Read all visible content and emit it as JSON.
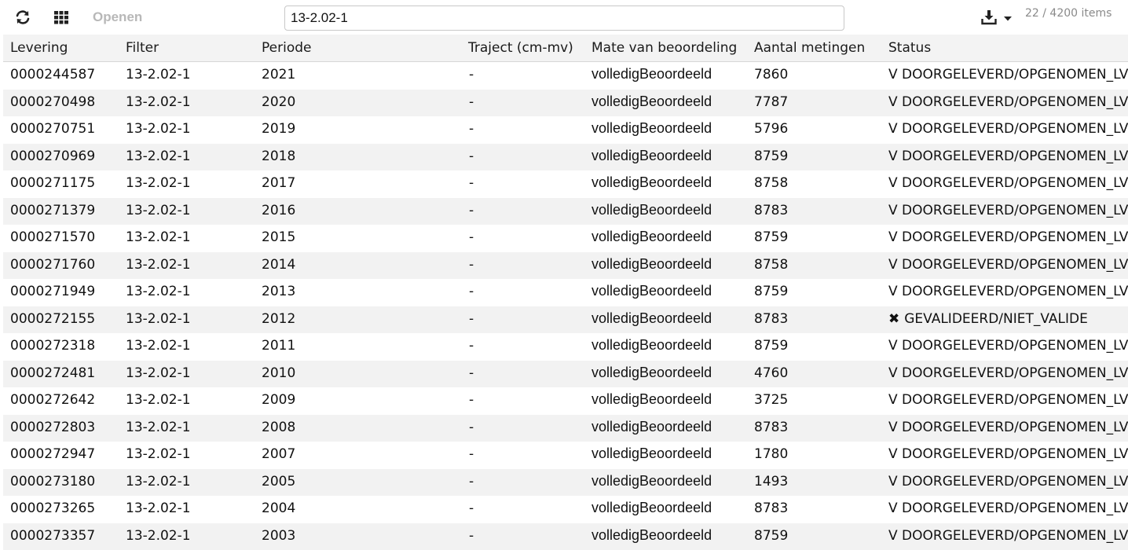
{
  "toolbar": {
    "refresh_icon": "refresh-icon",
    "grid_icon": "grid-icon",
    "open_label": "Openen",
    "search_value": "13-2.02-1",
    "download_icon": "download-icon",
    "dropdown_icon": "caret-down-icon",
    "item_count": "22 / 4200 items"
  },
  "table": {
    "headers": [
      "Levering",
      "Filter",
      "Periode",
      "Traject (cm-mv)",
      "Mate van beoordeling",
      "Aantal metingen",
      "Status"
    ],
    "rows": [
      {
        "levering": "0000244587",
        "filter": "13-2.02-1",
        "periode": "2021",
        "traject": "-",
        "mate": "volledigBeoordeeld",
        "aantal": "7860",
        "status_mark": "V",
        "status": "DOORGELEVERD/OPGENOMEN_LV"
      },
      {
        "levering": "0000270498",
        "filter": "13-2.02-1",
        "periode": "2020",
        "traject": "-",
        "mate": "volledigBeoordeeld",
        "aantal": "7787",
        "status_mark": "V",
        "status": "DOORGELEVERD/OPGENOMEN_LV"
      },
      {
        "levering": "0000270751",
        "filter": "13-2.02-1",
        "periode": "2019",
        "traject": "-",
        "mate": "volledigBeoordeeld",
        "aantal": "5796",
        "status_mark": "V",
        "status": "DOORGELEVERD/OPGENOMEN_LV"
      },
      {
        "levering": "0000270969",
        "filter": "13-2.02-1",
        "periode": "2018",
        "traject": "-",
        "mate": "volledigBeoordeeld",
        "aantal": "8759",
        "status_mark": "V",
        "status": "DOORGELEVERD/OPGENOMEN_LV"
      },
      {
        "levering": "0000271175",
        "filter": "13-2.02-1",
        "periode": "2017",
        "traject": "-",
        "mate": "volledigBeoordeeld",
        "aantal": "8758",
        "status_mark": "V",
        "status": "DOORGELEVERD/OPGENOMEN_LV"
      },
      {
        "levering": "0000271379",
        "filter": "13-2.02-1",
        "periode": "2016",
        "traject": "-",
        "mate": "volledigBeoordeeld",
        "aantal": "8783",
        "status_mark": "V",
        "status": "DOORGELEVERD/OPGENOMEN_LV"
      },
      {
        "levering": "0000271570",
        "filter": "13-2.02-1",
        "periode": "2015",
        "traject": "-",
        "mate": "volledigBeoordeeld",
        "aantal": "8759",
        "status_mark": "V",
        "status": "DOORGELEVERD/OPGENOMEN_LV"
      },
      {
        "levering": "0000271760",
        "filter": "13-2.02-1",
        "periode": "2014",
        "traject": "-",
        "mate": "volledigBeoordeeld",
        "aantal": "8758",
        "status_mark": "V",
        "status": "DOORGELEVERD/OPGENOMEN_LV"
      },
      {
        "levering": "0000271949",
        "filter": "13-2.02-1",
        "periode": "2013",
        "traject": "-",
        "mate": "volledigBeoordeeld",
        "aantal": "8759",
        "status_mark": "V",
        "status": "DOORGELEVERD/OPGENOMEN_LV"
      },
      {
        "levering": "0000272155",
        "filter": "13-2.02-1",
        "periode": "2012",
        "traject": "-",
        "mate": "volledigBeoordeeld",
        "aantal": "8783",
        "status_mark": "✖",
        "status": "GEVALIDEERD/NIET_VALIDE"
      },
      {
        "levering": "0000272318",
        "filter": "13-2.02-1",
        "periode": "2011",
        "traject": "-",
        "mate": "volledigBeoordeeld",
        "aantal": "8759",
        "status_mark": "V",
        "status": "DOORGELEVERD/OPGENOMEN_LV"
      },
      {
        "levering": "0000272481",
        "filter": "13-2.02-1",
        "periode": "2010",
        "traject": "-",
        "mate": "volledigBeoordeeld",
        "aantal": "4760",
        "status_mark": "V",
        "status": "DOORGELEVERD/OPGENOMEN_LV"
      },
      {
        "levering": "0000272642",
        "filter": "13-2.02-1",
        "periode": "2009",
        "traject": "-",
        "mate": "volledigBeoordeeld",
        "aantal": "3725",
        "status_mark": "V",
        "status": "DOORGELEVERD/OPGENOMEN_LV"
      },
      {
        "levering": "0000272803",
        "filter": "13-2.02-1",
        "periode": "2008",
        "traject": "-",
        "mate": "volledigBeoordeeld",
        "aantal": "8783",
        "status_mark": "V",
        "status": "DOORGELEVERD/OPGENOMEN_LV"
      },
      {
        "levering": "0000272947",
        "filter": "13-2.02-1",
        "periode": "2007",
        "traject": "-",
        "mate": "volledigBeoordeeld",
        "aantal": "1780",
        "status_mark": "V",
        "status": "DOORGELEVERD/OPGENOMEN_LV"
      },
      {
        "levering": "0000273180",
        "filter": "13-2.02-1",
        "periode": "2005",
        "traject": "-",
        "mate": "volledigBeoordeeld",
        "aantal": "1493",
        "status_mark": "V",
        "status": "DOORGELEVERD/OPGENOMEN_LV"
      },
      {
        "levering": "0000273265",
        "filter": "13-2.02-1",
        "periode": "2004",
        "traject": "-",
        "mate": "volledigBeoordeeld",
        "aantal": "8783",
        "status_mark": "V",
        "status": "DOORGELEVERD/OPGENOMEN_LV"
      },
      {
        "levering": "0000273357",
        "filter": "13-2.02-1",
        "periode": "2003",
        "traject": "-",
        "mate": "volledigBeoordeeld",
        "aantal": "8759",
        "status_mark": "V",
        "status": "DOORGELEVERD/OPGENOMEN_LV"
      }
    ]
  }
}
